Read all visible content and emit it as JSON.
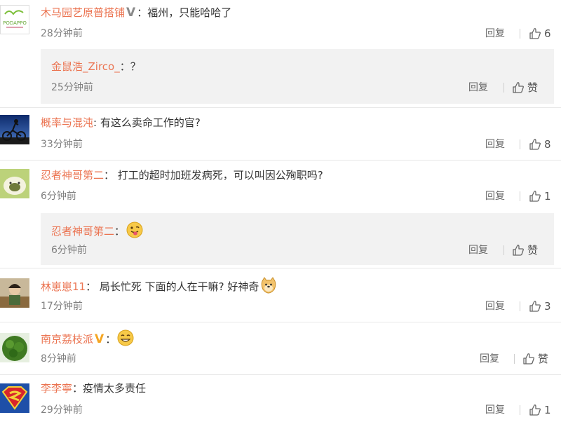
{
  "comments": [
    {
      "username": "木马园艺原普搭铺",
      "text": "：福州，只能哈哈了",
      "time": "28分钟前",
      "reply": "回复",
      "likes": "6",
      "replies": [
        {
          "username": "金鼠浩_Zirco_",
          "text": "：？",
          "time": "25分钟前",
          "reply": "回复",
          "like": "赞"
        }
      ]
    },
    {
      "username": "概率与混沌",
      "text": ": 有这么卖命工作的官?",
      "time": "33分钟前",
      "reply": "回复",
      "likes": "8"
    },
    {
      "username": "忍者神哥第二",
      "text": "： 打工的超时加班发病死，可以叫因公殉职吗?",
      "time": "6分钟前",
      "reply": "回复",
      "likes": "1",
      "replies": [
        {
          "username": "忍者神哥第二",
          "text": "：",
          "time": "6分钟前",
          "reply": "回复",
          "like": "赞"
        }
      ]
    },
    {
      "username": "林崽崽11",
      "text": "： 局长忙死 下面的人在干嘛? 好神奇",
      "time": "17分钟前",
      "reply": "回复",
      "likes": "3"
    },
    {
      "username": "南京荔枝派",
      "text": "：",
      "time": "8分钟前",
      "reply": "回复",
      "like": "赞"
    },
    {
      "username": "李李寧",
      "text": "：疫情太多责任",
      "time": "29分钟前",
      "reply": "回复",
      "likes": "1"
    }
  ],
  "avatar_text": "PODAPPO",
  "colors": {
    "username": "#eb7350",
    "text": "#333333",
    "meta": "#808080",
    "reply_bg": "#f2f2f2",
    "separator": "#e8e8e8"
  },
  "icons": [
    "verified-v-icon",
    "thumbs-up-icon",
    "tongue-emoji-icon",
    "doge-emoji-icon",
    "smile-emoji-icon"
  ]
}
